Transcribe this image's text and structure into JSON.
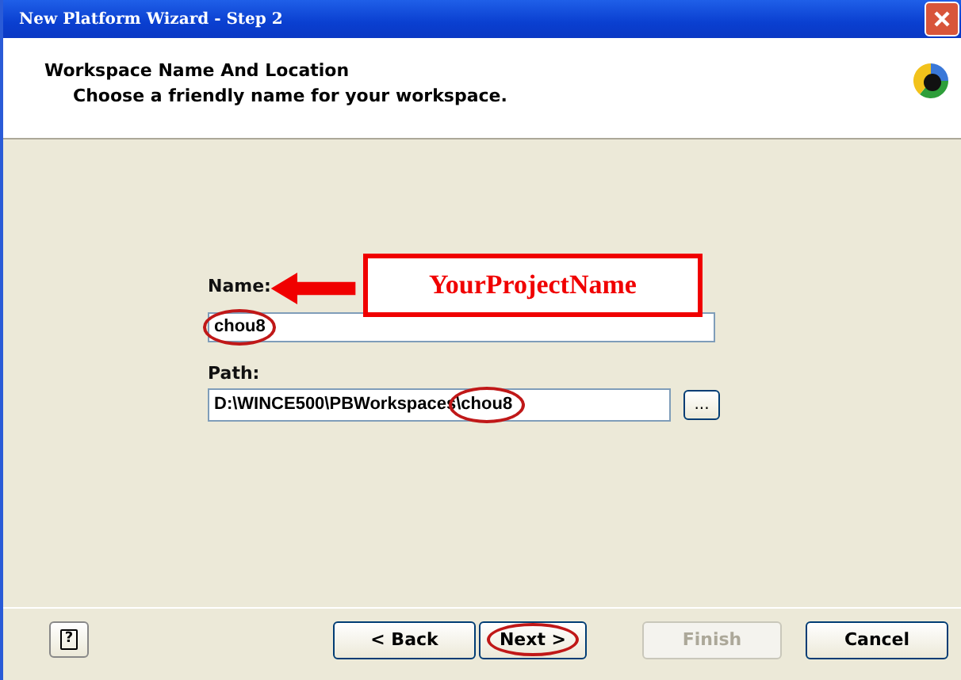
{
  "window": {
    "title": "New Platform Wizard - Step 2"
  },
  "header": {
    "title": "Workspace Name And Location",
    "subtitle": "Choose a friendly name for your workspace."
  },
  "form": {
    "name_label": "Name:",
    "name_value": "chou8",
    "path_label": "Path:",
    "path_value": "D:\\WINCE500\\PBWorkspaces\\chou8",
    "browse": "..."
  },
  "annotation": {
    "callout": "YourProjectName"
  },
  "help": "?",
  "buttons": [
    {
      "label": "< Back",
      "disabled": false,
      "highlighted": false
    },
    {
      "label": "Next >",
      "disabled": false,
      "highlighted": true
    },
    {
      "label": "Finish",
      "disabled": true,
      "highlighted": false
    },
    {
      "label": "Cancel",
      "disabled": false,
      "highlighted": false
    }
  ]
}
